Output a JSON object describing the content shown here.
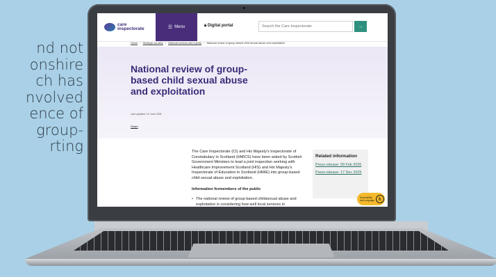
{
  "background_text": [
    "nd not",
    "onshire",
    "ch  has",
    "nvolved",
    "ence of",
    "group-",
    "rting"
  ],
  "header": {
    "logo_text_line1": "care",
    "logo_text_line2": "inspectorate",
    "menu_label": "Menu",
    "portal_label": "Digital portal",
    "search_placeholder": "Search the Care Inspectorate",
    "search_icon": "arrow-right-icon"
  },
  "breadcrumb": [
    "Home",
    "Strategic scrutiny",
    "National reviews and reports",
    "National review of group-based child sexual abuse and exploitation"
  ],
  "hero": {
    "title": "National review of group-based child sexual abuse and exploitation",
    "last_updated": "Last updated: 19 June 2026",
    "share": "Share"
  },
  "content": {
    "intro": "The Care Inspectorate (CI) and His Majesty's Inspectorate of Constabulary in Scotland (HMICS) have been asked by Scottish Government Ministers to lead a joint inspection working with Healthcare Improvement Scotland (HIS) and His Majesty's Inspectorate of Education in Scotland (HMIE) into group-based child sexual abuse and exploitation.",
    "public_heading": "Information formembers of the public",
    "bullet": "The national review of group-based childsexual abuse and exploitation is considering how well local services in"
  },
  "related": {
    "heading": "Related information",
    "links": [
      "Press release: 09 Feb 2026",
      "Press release: 17 Dec 2025"
    ]
  },
  "accessibility": {
    "label": "Accessibility and Language",
    "icon": "accessibility-icon"
  },
  "colors": {
    "brand_purple": "#4a2d7a",
    "title_purple": "#3c2a78",
    "accent_teal": "#2f9080",
    "access_yellow": "#f3b92a"
  }
}
